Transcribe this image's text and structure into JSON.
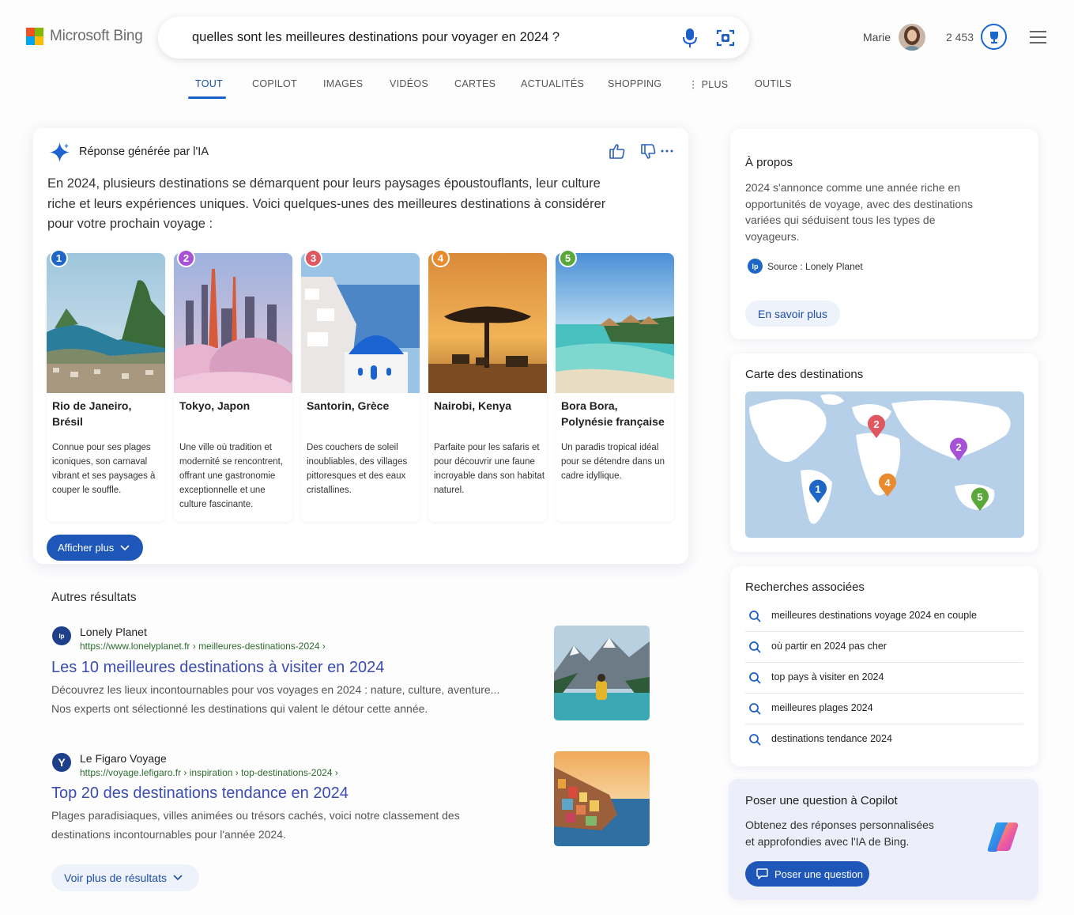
{
  "brand": {
    "name": "Microsoft Bing",
    "colors": [
      "#f25022",
      "#7fba00",
      "#00a4ef",
      "#ffb900"
    ]
  },
  "search": {
    "query": "quelles sont les meilleures destinations pour voyager en 2024 ?",
    "mic_icon": "microphone-icon",
    "visual_icon": "visual-search-icon"
  },
  "user": {
    "name": "Marie",
    "points": "2 453"
  },
  "tabs": [
    {
      "label": "TOUT",
      "active": true
    },
    {
      "label": "COPILOT"
    },
    {
      "label": "IMAGES"
    },
    {
      "label": "VIDÉOS"
    },
    {
      "label": "CARTES"
    },
    {
      "label": "ACTUALITÉS"
    },
    {
      "label": "SHOPPING"
    },
    {
      "label": "⋮ PLUS"
    },
    {
      "label": "OUTILS"
    }
  ],
  "ai_answer": {
    "header": "Réponse générée par l'IA",
    "intro": "En 2024, plusieurs destinations se démarquent pour leurs paysages époustouflants, leur culture riche et leurs expériences uniques. Voici quelques-unes des meilleures destinations à considérer pour votre prochain voyage :",
    "destinations": [
      {
        "num": "1",
        "badge_color": "#1e67c6",
        "name": "Rio de Janeiro, Brésil",
        "desc": "Connue pour ses plages iconiques, son carnaval vibrant et ses paysages à couper le souffle."
      },
      {
        "num": "2",
        "badge_color": "#a552d6",
        "name": "Tokyo, Japon",
        "desc": "Une ville où tradition et modernité se rencontrent, offrant une gastronomie exceptionnelle et une culture fascinante."
      },
      {
        "num": "3",
        "badge_color": "#e0575f",
        "name": "Santorin, Grèce",
        "desc": "Des couchers de soleil inoubliables, des villages pittoresques et des eaux cristallines."
      },
      {
        "num": "4",
        "badge_color": "#e98a2c",
        "name": "Nairobi, Kenya",
        "desc": "Parfaite pour les safaris et pour découvrir une faune incroyable dans son habitat naturel."
      },
      {
        "num": "5",
        "badge_color": "#5ba83a",
        "name": "Bora Bora, Polynésie française",
        "desc": "Un paradis tropical idéal pour se détendre dans un cadre idyllique."
      }
    ],
    "show_more": "Afficher plus"
  },
  "results": {
    "title": "Autres résultats",
    "items": [
      {
        "site": "Lonely Planet",
        "url": "https://www.lonelyplanet.fr › meilleures-destinations-2024 ›",
        "title": "Les 10 meilleures destinations à visiter en 2024",
        "desc": "Découvrez les lieux incontournables pour vos voyages en 2024 : nature, culture, aventure... Nos experts ont sélectionné les destinations qui valent le détour cette année.",
        "icon_text": "lp"
      },
      {
        "site": "Le Figaro Voyage",
        "url": "https://voyage.lefigaro.fr › inspiration › top-destinations-2024 ›",
        "title": "Top 20 des destinations tendance en 2024",
        "desc": "Plages paradisiaques, villes animées ou trésors cachés, voici notre classement des destinations incontournables pour l'année 2024.",
        "icon_text": "Y"
      }
    ],
    "more_button": "Voir plus de résultats"
  },
  "about": {
    "title": "À propos",
    "text": "2024 s'annonce comme une année riche en opportunités de voyage, avec des destinations variées qui séduisent tous les types de voyageurs.",
    "source": "Source : Lonely Planet",
    "source_icon_text": "lp",
    "button": "En savoir plus"
  },
  "map_card": {
    "title": "Carte des destinations",
    "pins": [
      "2",
      "2",
      "1",
      "4",
      "5"
    ]
  },
  "related": {
    "title": "Recherches associées",
    "items": [
      "meilleures destinations voyage 2024 en couple",
      "où partir en 2024 pas cher",
      "top pays à visiter en 2024",
      "meilleures plages 2024",
      "destinations tendance 2024"
    ]
  },
  "copilot": {
    "title": "Poser une question à Copilot",
    "text": "Obtenez des réponses personnalisées et approfondies avec l'IA de Bing.",
    "button": "Poser une question"
  }
}
